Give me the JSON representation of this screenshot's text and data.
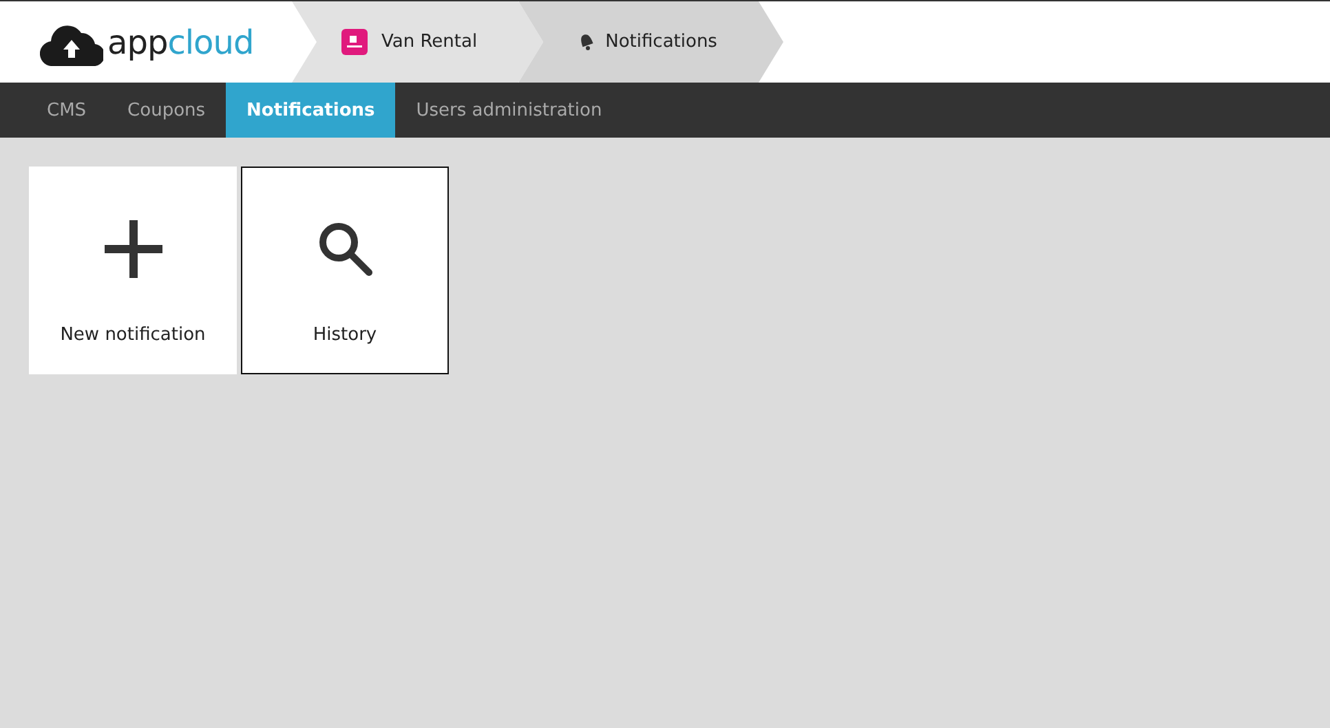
{
  "logo": {
    "text_dark": "app",
    "text_accent": "cloud"
  },
  "breadcrumbs": [
    {
      "kind": "app",
      "label": "Van Rental"
    },
    {
      "kind": "section",
      "label": "Notifications"
    }
  ],
  "nav": [
    {
      "label": "CMS",
      "selected": false
    },
    {
      "label": "Coupons",
      "selected": false
    },
    {
      "label": "Notifications",
      "selected": true
    },
    {
      "label": "Users administration",
      "selected": false
    }
  ],
  "tiles": [
    {
      "kind": "add",
      "label": "New notification",
      "selected": false
    },
    {
      "kind": "search",
      "label": "History",
      "selected": true
    }
  ]
}
